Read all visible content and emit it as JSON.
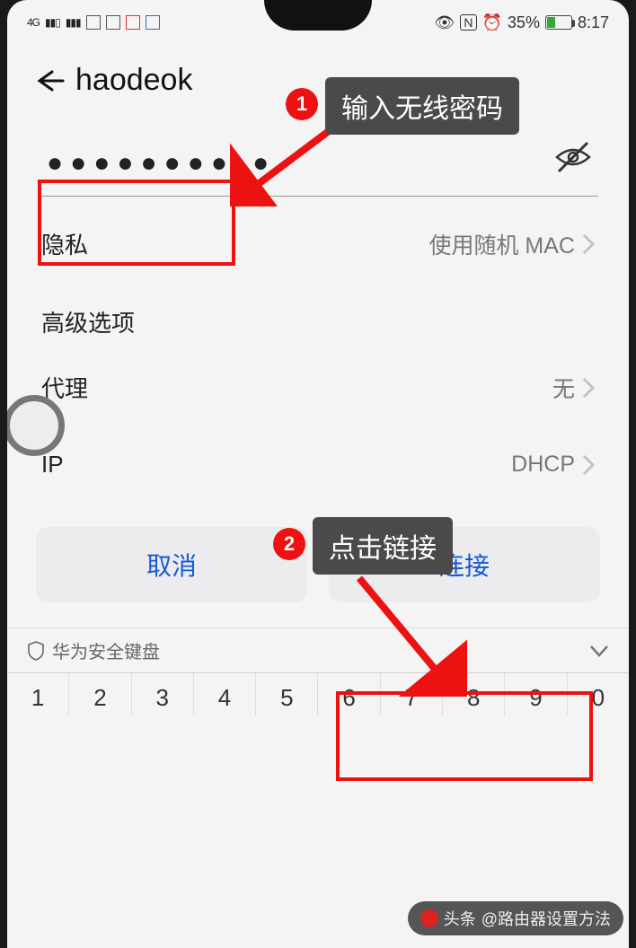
{
  "status": {
    "signal_label": "4G",
    "nfc": "N",
    "battery_percent": "35%",
    "time": "8:17"
  },
  "header": {
    "title": "haodeok"
  },
  "password": {
    "masked_before": "●●●●●●●●",
    "masked_after": "●●"
  },
  "rows": {
    "privacy_label": "隐私",
    "privacy_value": "使用随机 MAC",
    "advanced_label": "高级选项",
    "proxy_label": "代理",
    "proxy_value": "无",
    "ip_label": "IP",
    "ip_value": "DHCP"
  },
  "buttons": {
    "cancel": "取消",
    "connect": "连接"
  },
  "keyboard": {
    "secure_label": "华为安全键盘",
    "keys": [
      "1",
      "2",
      "3",
      "4",
      "5",
      "6",
      "7",
      "8",
      "9",
      "0"
    ]
  },
  "annotations": {
    "step1_num": "1",
    "step1_text": "输入无线密码",
    "step2_num": "2",
    "step2_text": "点击链接"
  },
  "watermark": {
    "prefix": "头条",
    "handle": "@路由器设置方法"
  }
}
